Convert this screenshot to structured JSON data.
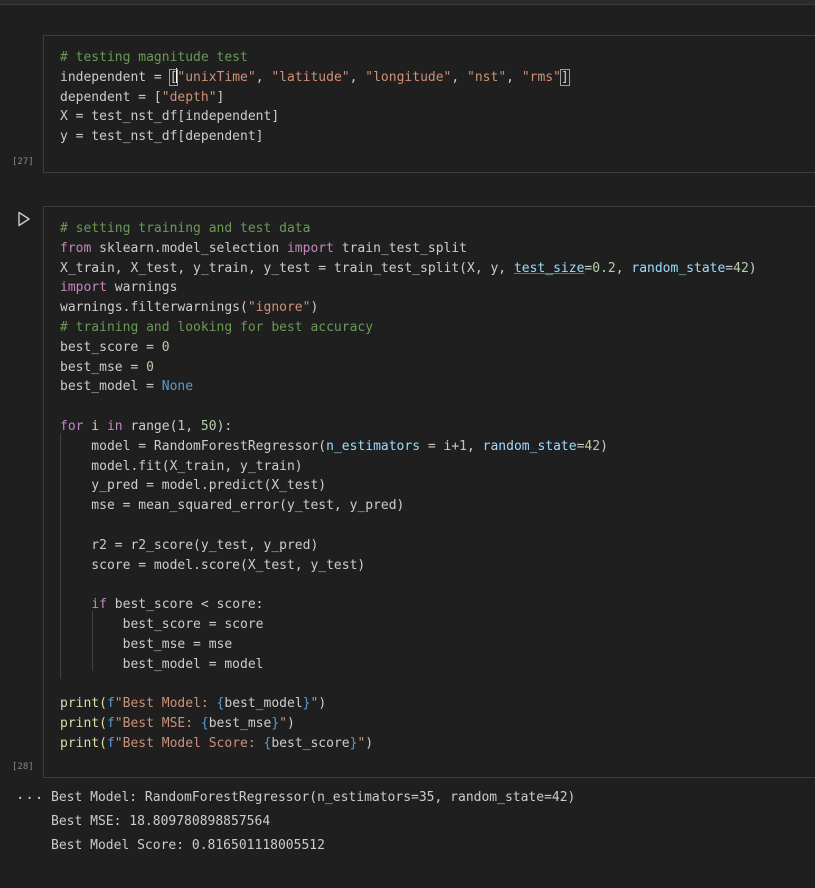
{
  "cell1": {
    "execution_count": "[27]",
    "lines": {
      "l1": "# testing magnitude test",
      "l2": {
        "a": "independent = ",
        "b": "[",
        "c": "\"unixTime\"",
        "d": ", ",
        "e": "\"latitude\"",
        "f": ", ",
        "g": "\"longitude\"",
        "h": ", ",
        "i": "\"nst\"",
        "j": ", ",
        "k": "\"rms\"",
        "l": "]"
      },
      "l3": {
        "a": "dependent = [",
        "b": "\"depth\"",
        "c": "]"
      },
      "l4": "X = test_nst_df[independent]",
      "l5": "y = test_nst_df[dependent]"
    }
  },
  "cell2": {
    "execution_count": "[28]",
    "run_icon": "play-icon",
    "lines": {
      "l1": "# setting training and test data",
      "l2": {
        "a": "from",
        "b": " sklearn.model_selection ",
        "c": "import",
        "d": " train_test_split"
      },
      "l3": {
        "a": "X_train, X_test, y_train, y_test = train_test_split(X, y, ",
        "b": "test_size",
        "c": "=",
        "d": "0.2",
        "e": ", ",
        "f": "random_state",
        "g": "=",
        "h": "42",
        "i": ")"
      },
      "l4": {
        "a": "import",
        "b": " warnings"
      },
      "l5": {
        "a": "warnings.filterwarnings(",
        "b": "\"ignore\"",
        "c": ")"
      },
      "l6": "# training and looking for best accuracy",
      "l7": {
        "a": "best_score = ",
        "b": "0"
      },
      "l8": {
        "a": "best_mse = ",
        "b": "0"
      },
      "l9": {
        "a": "best_model = ",
        "b": "None"
      },
      "l11": {
        "a": "for",
        "b": " i ",
        "c": "in",
        "d": " range(",
        "e": "1",
        "f": ", ",
        "g": "50",
        "h": "):"
      },
      "l12": {
        "a": "    model = RandomForestRegressor(",
        "b": "n_estimators",
        "c": " = i+",
        "d": "1",
        "e": ", ",
        "f": "random_state",
        "g": "=",
        "h": "42",
        "i": ")"
      },
      "l13": "    model.fit(X_train, y_train)",
      "l14": "    y_pred = model.predict(X_test)",
      "l15": "    mse = mean_squared_error(y_test, y_pred)",
      "l17": "    r2 = r2_score(y_test, y_pred)",
      "l18": "    score = model.score(X_test, y_test)",
      "l20": {
        "a": "    ",
        "b": "if",
        "c": " best_score < score:"
      },
      "l21": "        best_score = score",
      "l22": "        best_mse = mse",
      "l23": "        best_model = model",
      "l25": {
        "a": "print(",
        "b": "f",
        "c": "\"Best Model: ",
        "d": "{",
        "e": "best_model",
        "f": "}",
        "g": "\"",
        "h": ")"
      },
      "l26": {
        "a": "print(",
        "b": "f",
        "c": "\"Best MSE: ",
        "d": "{",
        "e": "best_mse",
        "f": "}",
        "g": "\"",
        "h": ")"
      },
      "l27": {
        "a": "print(",
        "b": "f",
        "c": "\"Best Model Score: ",
        "d": "{",
        "e": "best_score",
        "f": "}",
        "g": "\"",
        "h": ")"
      }
    }
  },
  "output": {
    "toggle_label": "...",
    "lines": [
      "Best Model: RandomForestRegressor(n_estimators=35, random_state=42)",
      "Best MSE: 18.809780898857564",
      "Best Model Score: 0.816501118005512"
    ]
  },
  "colors": {
    "background": "#1f1f1f",
    "comment": "#6a9955",
    "keyword": "#c586c0",
    "constant": "#569cd6",
    "string": "#ce9178",
    "number": "#b5cea8",
    "parameter": "#9cdcfe",
    "text": "#cccccc"
  }
}
